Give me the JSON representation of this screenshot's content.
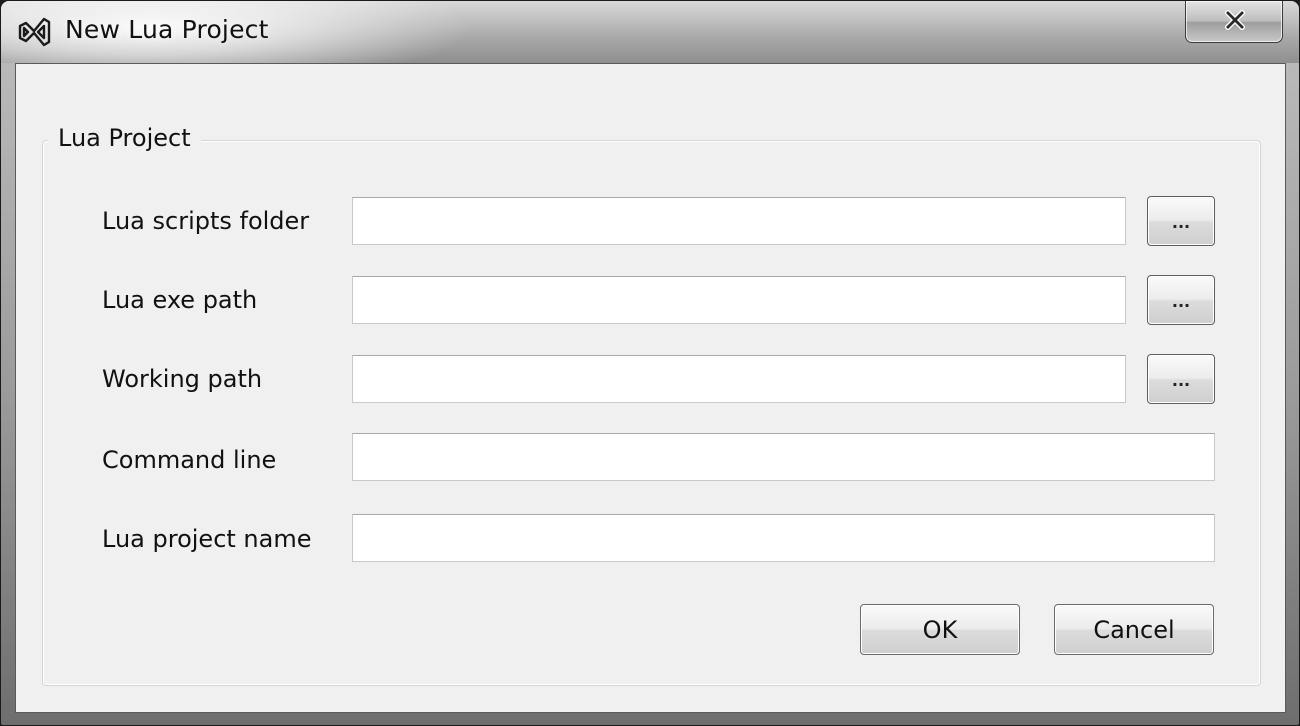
{
  "window": {
    "title": "New Lua Project",
    "icon": "visual-studio-icon",
    "close_icon": "close-x-icon"
  },
  "group": {
    "title": "Lua Project"
  },
  "fields": [
    {
      "label": "Lua scripts folder",
      "value": "",
      "browse_label": "..."
    },
    {
      "label": "Lua exe path",
      "value": "",
      "browse_label": "..."
    },
    {
      "label": "Working path",
      "value": "",
      "browse_label": "..."
    },
    {
      "label": "Command line",
      "value": ""
    },
    {
      "label": "Lua project name",
      "value": ""
    }
  ],
  "buttons": {
    "ok_label": "OK",
    "cancel_label": "Cancel"
  }
}
